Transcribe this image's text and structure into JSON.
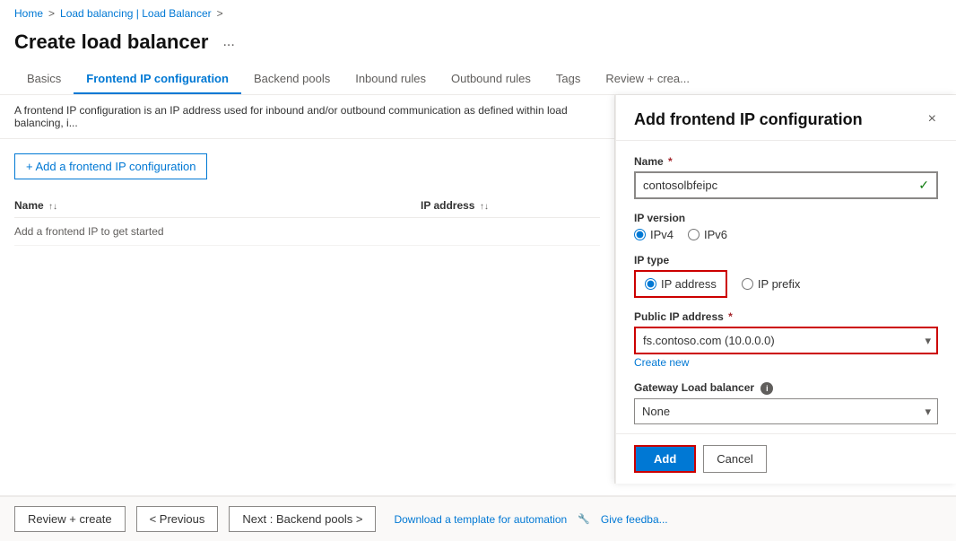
{
  "breadcrumb": {
    "home": "Home",
    "separator1": ">",
    "loadbalancing": "Load balancing | Load Balancer",
    "separator2": ">"
  },
  "page": {
    "title": "Create load balancer",
    "ellipsis": "..."
  },
  "tabs": [
    {
      "id": "basics",
      "label": "Basics",
      "active": false
    },
    {
      "id": "frontend-ip",
      "label": "Frontend IP configuration",
      "active": true
    },
    {
      "id": "backend-pools",
      "label": "Backend pools",
      "active": false
    },
    {
      "id": "inbound-rules",
      "label": "Inbound rules",
      "active": false
    },
    {
      "id": "outbound-rules",
      "label": "Outbound rules",
      "active": false
    },
    {
      "id": "tags",
      "label": "Tags",
      "active": false
    },
    {
      "id": "review-create",
      "label": "Review + crea...",
      "active": false
    }
  ],
  "description": "A frontend IP configuration is an IP address used for inbound and/or outbound communication as defined within load balancing, i...",
  "table": {
    "columns": [
      {
        "id": "name",
        "label": "Name",
        "sortable": true
      },
      {
        "id": "ip-address",
        "label": "IP address",
        "sortable": true
      }
    ],
    "empty_row": "Add a frontend IP to get started"
  },
  "add_button": "+ Add a frontend IP configuration",
  "side_panel": {
    "title": "Add frontend IP configuration",
    "close_label": "×",
    "fields": {
      "name": {
        "label": "Name",
        "required": true,
        "value": "contosolbfeipc",
        "placeholder": ""
      },
      "ip_version": {
        "label": "IP version",
        "options": [
          {
            "value": "ipv4",
            "label": "IPv4",
            "selected": true
          },
          {
            "value": "ipv6",
            "label": "IPv6",
            "selected": false
          }
        ]
      },
      "ip_type": {
        "label": "IP type",
        "options": [
          {
            "value": "ip-address",
            "label": "IP address",
            "selected": true
          },
          {
            "value": "ip-prefix",
            "label": "IP prefix",
            "selected": false
          }
        ]
      },
      "public_ip": {
        "label": "Public IP address",
        "required": true,
        "value": "fs.contoso.com (10.0.0.0)",
        "create_new": "Create new"
      },
      "gateway_lb": {
        "label": "Gateway Load balancer",
        "info": true,
        "value": "None",
        "options": [
          "None"
        ]
      }
    },
    "add_btn": "Add",
    "cancel_btn": "Cancel"
  },
  "bottom_bar": {
    "review_create": "Review + create",
    "previous": "< Previous",
    "next": "Next : Backend pools >",
    "download_link": "Download a template for automation",
    "feedback": "Give feedba..."
  }
}
